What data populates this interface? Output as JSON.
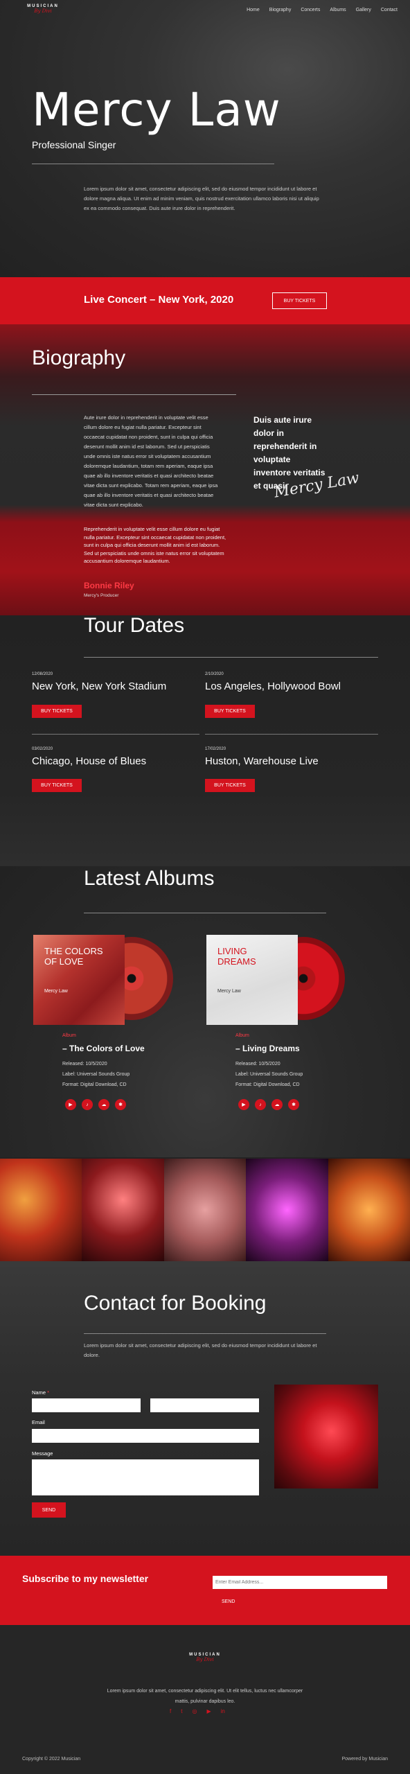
{
  "header": {
    "brand": "MUSICIAN",
    "brand_script": "By Divi",
    "nav": [
      "Home",
      "Biography",
      "Concerts",
      "Albums",
      "Gallery",
      "Contact"
    ]
  },
  "hero": {
    "title": "Mercy Law",
    "subtitle": "Professional Singer",
    "text": "Lorem ipsum dolor sit amet, consectetur adipiscing elit, sed do eiusmod tempor incididunt ut labore et dolore magna aliqua. Ut enim ad minim veniam, quis nostrud exercitation ullamco laboris nisi ut aliquip ex ea commodo consequat. Duis aute irure dolor in reprehenderit."
  },
  "concert": {
    "title": "Live Concert – New York, 2020",
    "button": "BUY TICKETS"
  },
  "biography": {
    "title": "Biography",
    "text1": "Aute irure dolor in reprehenderit in voluptate velit esse cillum dolore eu fugiat nulla pariatur. Excepteur sint occaecat cupidatat non proident, sunt in culpa qui officia deserunt mollit anim id est laborum. Sed ut perspiciatis unde omnis iste natus error sit voluptatem accusantium doloremque laudantium, totam rem aperiam, eaque ipsa quae ab illo inventore veritatis et quasi architecto beatae vitae dicta sunt explicabo. Totam rem aperiam, eaque ipsa quae ab illo inventore veritatis et quasi architecto beatae vitae dicta sunt explicabo.",
    "text2": "Reprehenderit in voluptate velit esse cillum dolore eu fugiat nulla pariatur. Excepteur sint occaecat cupidatat non proident, sunt in culpa qui officia deserunt mollit anim id est laborum. Sed ut perspiciatis unde omnis iste natus error sit voluptatem accusantium doloremque laudantium.",
    "quote": "Duis aute irure dolor in reprehenderit in voluptate inventore veritatis et quasi.",
    "signature": "Mercy Law",
    "name": "Bonnie Riley",
    "role": "Mercy's Producer"
  },
  "tour": {
    "title": "Tour Dates",
    "events": [
      {
        "date": "12/08/2020",
        "venue": "New York, New York Stadium",
        "button": "BUY TICKETS"
      },
      {
        "date": "2/10/2020",
        "venue": "Los Angeles, Hollywood Bowl",
        "button": "BUY TICKETS"
      },
      {
        "date": "03/02/2020",
        "venue": "Chicago, House of Blues",
        "button": "BUY TICKETS"
      },
      {
        "date": "17/02/2020",
        "venue": "Huston, Warehouse Live",
        "button": "BUY TICKETS"
      }
    ]
  },
  "albums": {
    "title": "Latest Albums",
    "items": [
      {
        "cover_title": "THE COLORS OF LOVE",
        "cover_artist": "Mercy Law",
        "label_red": "Album",
        "name": "– The Colors of Love",
        "released": "Released: 10/5/2020",
        "label": "Label: Universal Sounds Group",
        "format": "Format: Digital Download, CD"
      },
      {
        "cover_title": "LIVING DREAMS",
        "cover_artist": "Mercy Law",
        "label_red": "Album",
        "name": "– Living Dreams",
        "released": "Released: 10/5/2020",
        "label": "Label: Universal Sounds Group",
        "format": "Format: Digital Download, CD"
      }
    ],
    "social_icons": [
      "play-icon",
      "music-icon",
      "cloud-icon",
      "star-icon"
    ]
  },
  "gallery": {
    "colors": [
      "#c0331b",
      "#8c1a1d",
      "#a45a5a",
      "#7a1e7a",
      "#c7501a"
    ]
  },
  "contact": {
    "title": "Contact for Booking",
    "text": "Lorem ipsum dolor sit amet, consectetur adipiscing elit, sed do eiusmod tempor incididunt ut labore et dolore.",
    "name_label": "Name",
    "required": "*",
    "email_label": "Email",
    "message_label": "Message",
    "send": "SEND"
  },
  "newsletter": {
    "title": "Subscribe to my newsletter",
    "placeholder": "Enter Email Address...",
    "button": "SEND"
  },
  "footer": {
    "brand": "MUSICIAN",
    "brand_script": "By Divi",
    "text": "Lorem ipsum dolor sit amet, consectetur adipiscing elit. Ut elit tellus, luctus nec ullamcorper mattis, pulvinar dapibus leo.",
    "social": [
      "f",
      "t",
      "◎",
      "▶",
      "in"
    ],
    "copyright": "Copyright © 2022 Musician",
    "powered": "Powered by Musician"
  }
}
